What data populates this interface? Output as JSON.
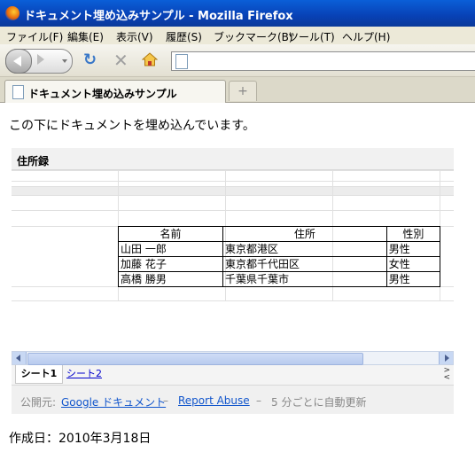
{
  "window": {
    "title": "ドキュメント埋め込みサンプル - Mozilla Firefox"
  },
  "menu": [
    "ファイル(F)",
    "編集(E)",
    "表示(V)",
    "履歴(S)",
    "ブックマーク(B)",
    "ツール(T)",
    "ヘルプ(H)"
  ],
  "tab": {
    "title": "ドキュメント埋め込みサンプル",
    "new_tab_symbol": "+"
  },
  "page": {
    "intro": "この下にドキュメントを埋め込んでいます。",
    "created": "作成日：2010年3月18日"
  },
  "spreadsheet": {
    "title": "住所録",
    "headers": [
      "名前",
      "住所",
      "性別"
    ],
    "rows": [
      [
        "山田 一郎",
        "東京都港区",
        "男性"
      ],
      [
        "加藤 花子",
        "東京都千代田区",
        "女性"
      ],
      [
        "高橋 勝男",
        "千葉県千葉市",
        "男性"
      ]
    ],
    "sheets": [
      "シート1",
      "シート2"
    ],
    "footer": {
      "published_by": "公開元:",
      "google_docs": "Google ドキュメント",
      "sep1": "–",
      "report_abuse": "Report Abuse",
      "sep2": "–",
      "update_note": "5 分ごとに自動更新"
    }
  }
}
